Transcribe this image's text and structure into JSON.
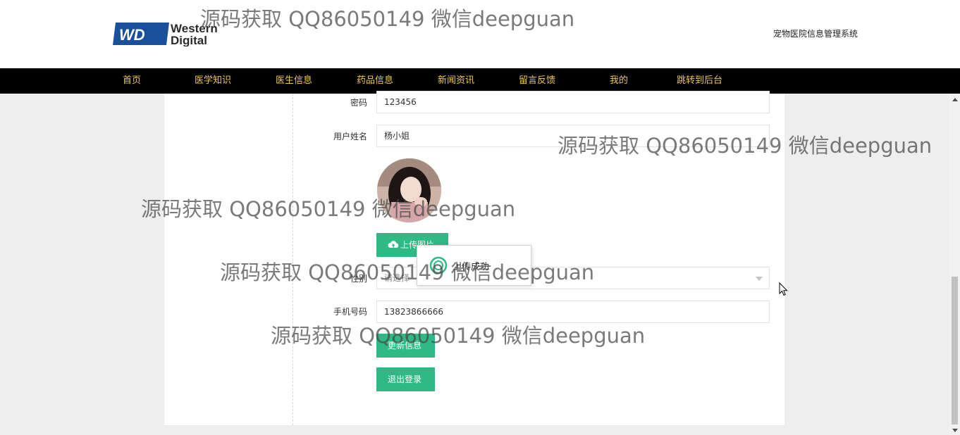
{
  "header": {
    "logo_text_line1": "Western",
    "logo_text_line2": "Digital",
    "logo_badge": "WD",
    "site_title": "宠物医院信息管理系统"
  },
  "nav": {
    "items": [
      {
        "label": "首页"
      },
      {
        "label": "医学知识"
      },
      {
        "label": "医生信息"
      },
      {
        "label": "药品信息"
      },
      {
        "label": "新闻资讯"
      },
      {
        "label": "留言反馈"
      },
      {
        "label": "我的"
      },
      {
        "label": "跳转到后台"
      }
    ]
  },
  "form": {
    "password_label": "密码",
    "password_value": "123456",
    "name_label": "用户姓名",
    "name_value": "杨小姐",
    "upload_button": "上传图片",
    "gender_label": "性别",
    "gender_placeholder": "请选择",
    "phone_label": "手机号码",
    "phone_value": "13823866666",
    "update_button": "更新信息",
    "logout_button": "退出登录"
  },
  "toast": {
    "message": "上传成功"
  },
  "watermarks": [
    "源码获取 QQ86050149 微信deepguan",
    "源码获取 QQ86050149 微信deepguan",
    "源码获取 QQ86050149 微信deepguan",
    "源码获取 QQ86050149 微信deepguan",
    "源码获取 QQ86050149 微信deepguan"
  ],
  "colors": {
    "nav_bg": "#000000",
    "nav_text": "#f1c74a",
    "button_green": "#2fb985",
    "logo_blue": "#1a4f9c"
  }
}
